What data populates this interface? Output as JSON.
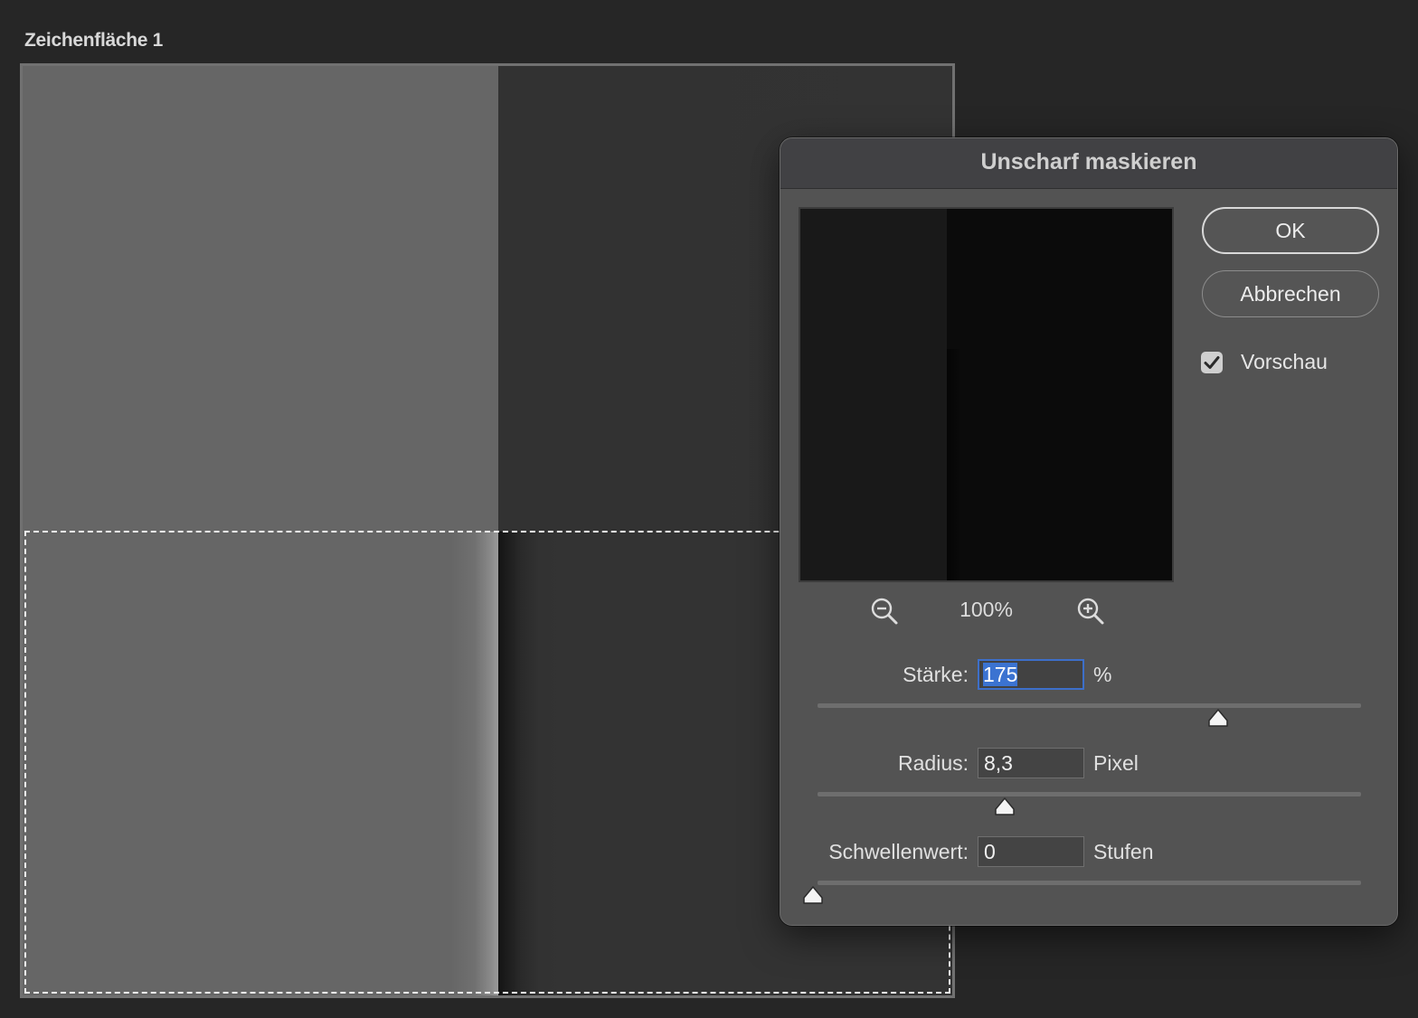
{
  "artboard": {
    "title": "Zeichenfläche 1"
  },
  "dialog": {
    "title": "Unscharf maskieren",
    "preview_zoom": "100%",
    "buttons": {
      "ok_label": "OK",
      "cancel_label": "Abbrechen"
    },
    "preview_toggle": {
      "label": "Vorschau",
      "checked": true
    },
    "params": {
      "amount": {
        "label": "Stärke:",
        "value": "175",
        "unit": "%",
        "slider_fraction": 0.745
      },
      "radius": {
        "label": "Radius:",
        "value": "8,3",
        "unit": "Pixel",
        "slider_fraction": 0.352
      },
      "threshold": {
        "label": "Schwellenwert:",
        "value": "0",
        "unit": "Stufen",
        "slider_fraction": 0.0
      }
    },
    "icons": {
      "zoom_out": "zoom-out-icon",
      "zoom_in": "zoom-in-icon",
      "checkbox": "checkmark-icon",
      "slider_thumb": "triangle-thumb-icon"
    }
  },
  "colors": {
    "workspace_bg": "#262626",
    "dialog_bg": "#535353",
    "focus_accent": "#3d6fc9"
  }
}
